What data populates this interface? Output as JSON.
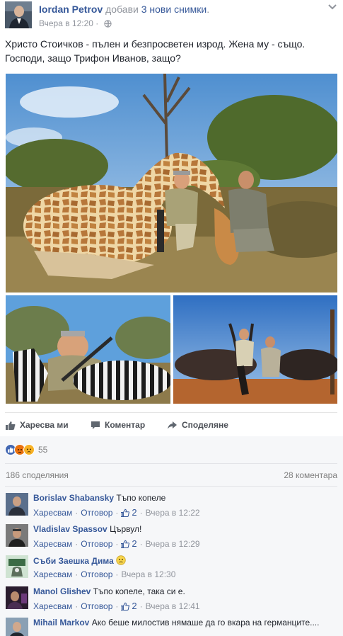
{
  "post": {
    "author": "Iordan Petrov",
    "action": "добави",
    "photos_link": "3 нови снимки",
    "period": ".",
    "time": "Вчера в 12:20",
    "separator": "·",
    "text": "Христо Стоичков - пълен и безпросветен изрод. Жена му - също. Господи, защо Трифон Иванов, защо?"
  },
  "actions": {
    "like": "Харесва ми",
    "comment": "Коментар",
    "share": "Споделяне"
  },
  "reactions": {
    "count": "55",
    "types": [
      "like-icon",
      "angry-icon",
      "sad-icon"
    ]
  },
  "stats": {
    "shares": "186 споделяния",
    "comments": "28 коментара"
  },
  "comment_actions": {
    "like": "Харесвам",
    "reply": "Отговор",
    "separator": "·"
  },
  "comments": [
    {
      "name": "Borislav Shabansky",
      "text": "Тъпо копеле",
      "likes": "2",
      "time": "Вчера в 12:22"
    },
    {
      "name": "Vladislav Spassov",
      "text": "Цървул!",
      "likes": "2",
      "time": "Вчера в 12:29"
    },
    {
      "name": "Съби Заешка Дима",
      "text": "",
      "likes": "",
      "time": "Вчера в 12:30"
    },
    {
      "name": "Manol Glishev",
      "text": "Тъпо копеле, така си е.",
      "likes": "2",
      "time": "Вчера в 12:41"
    },
    {
      "name": "Mihail Markov",
      "text": "Ако беше милостив нямаше да го вкара на германците....",
      "likes": "",
      "time": ""
    }
  ],
  "colors": {
    "link": "#365899",
    "secondary_text": "#90949c",
    "comment_bg": "#f6f7f9",
    "like_blue": "#4267b2",
    "angry_orange": "#e9710f",
    "sad_yellow": "#f7b125"
  }
}
